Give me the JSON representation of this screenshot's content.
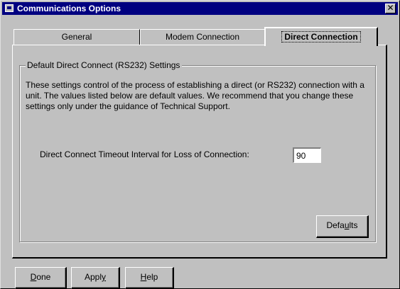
{
  "window": {
    "title": "Communications Options",
    "close_glyph": "✕"
  },
  "tabs": [
    {
      "label": "General",
      "active": false
    },
    {
      "label": "Modem Connection",
      "active": false
    },
    {
      "label": "Direct Connection",
      "active": true
    }
  ],
  "group": {
    "label": "Default Direct Connect (RS232) Settings",
    "description": "These settings control of the process of establishing a direct (or RS232) connection with a unit.  The values listed below are default values.  We recommend that you change these settings only under the guidance of Technical Support."
  },
  "timeout": {
    "label": "Direct Connect Timeout Interval for Loss of Connection:",
    "value": "90"
  },
  "buttons": {
    "defaults_pre": "Defa",
    "defaults_u": "u",
    "defaults_post": "lts",
    "done_u": "D",
    "done_post": "one",
    "apply_pre": "Appl",
    "apply_u": "y",
    "help_u": "H",
    "help_post": "elp"
  },
  "colors": {
    "titlebar": "#000080",
    "face": "#c0c0c0"
  },
  "icons": {
    "window": "app-window-icon",
    "close": "close-icon"
  }
}
